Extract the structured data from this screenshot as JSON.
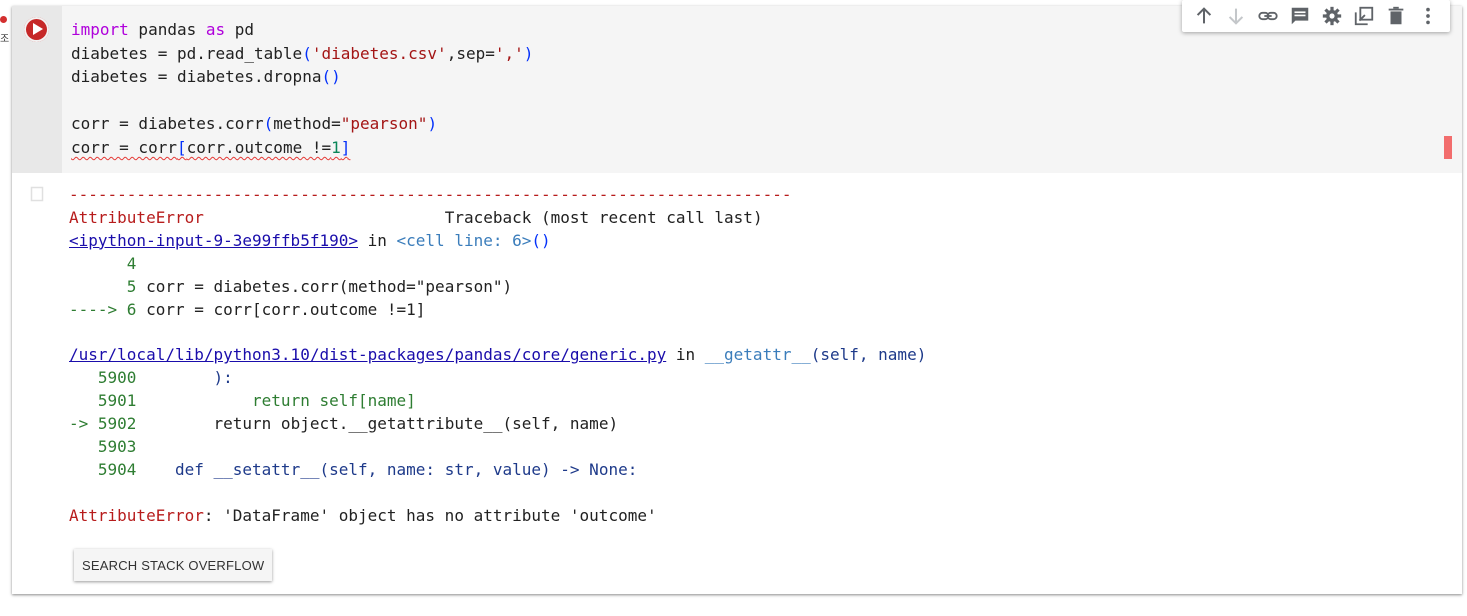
{
  "page": {
    "edge_char": "조"
  },
  "cell": {
    "code_lines": [
      [
        "import",
        " pandas ",
        "as",
        " pd"
      ],
      [
        "diabetes = pd.read_table",
        "(",
        "'diabetes.csv'",
        ",sep=",
        "','",
        ")"
      ],
      [
        "diabetes = diabetes.dropna",
        "()"
      ],
      [
        ""
      ],
      [
        "corr = diabetes.corr",
        "(",
        "method=",
        "\"pearson\"",
        ")"
      ],
      [
        "corr = corr",
        "[",
        "corr.outcome !=",
        "1",
        "]"
      ]
    ]
  },
  "toolbar": {
    "icons": [
      "arrow-up-icon",
      "arrow-down-icon",
      "link-icon",
      "comment-icon",
      "settings-icon",
      "mirror-cell-icon",
      "delete-icon",
      "more-options-icon"
    ]
  },
  "output": {
    "rule": "---------------------------------------------------------------------------",
    "error_name": "AttributeError",
    "traceback_header": "Traceback (most recent call last)",
    "input_link": "<ipython-input-9-3e99ffb5f190>",
    "in_word": " in ",
    "cell_ref": "<cell line: 6>",
    "call_parens": "()",
    "frame1": [
      {
        "marker": "      4",
        "code": ""
      },
      {
        "marker": "      5",
        "code": " corr = diabetes.corr(method=\"pearson\")"
      },
      {
        "marker": "----> 6",
        "code": " corr = corr[corr.outcome !=1]"
      }
    ],
    "path_link": "/usr/local/lib/python3.10/dist-packages/pandas/core/generic.py",
    "func_name": "__getattr__",
    "func_args": "(self, name)",
    "frame2": [
      {
        "marker": "   5900",
        "code": "        ):"
      },
      {
        "marker": "   5901",
        "code": "            return self[name]"
      },
      {
        "marker": "-> 5902",
        "code": "        return object.__getattribute__(self, name)"
      },
      {
        "marker": "   5903",
        "code": ""
      },
      {
        "marker": "   5904",
        "code": "    def __setattr__(self, name: str, value) -> None:"
      }
    ],
    "final_error_name": "AttributeError",
    "final_message": ": 'DataFrame' object has no attribute 'outcome'"
  },
  "search_button": {
    "label": "SEARCH STACK OVERFLOW"
  }
}
